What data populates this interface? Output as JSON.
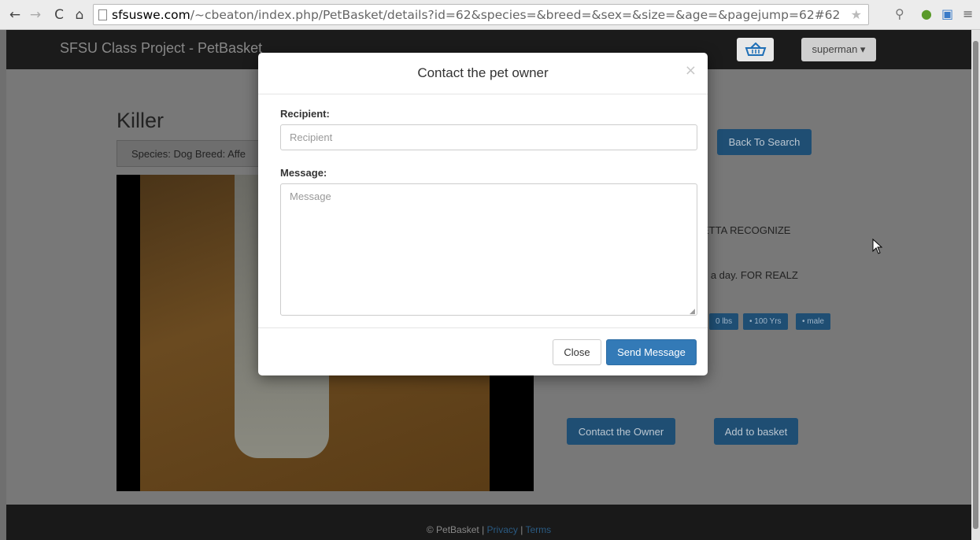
{
  "browser": {
    "url_host": "sfsuswe.com",
    "url_path": "/~cbeaton/index.php/PetBasket/details?id=62&species=&breed=&sex=&size=&age=&pagejump=62#62"
  },
  "navbar": {
    "brand": "SFSU Class Project - PetBasket",
    "user_menu": "superman ▾"
  },
  "pet": {
    "name": "Killer",
    "meta": "Species: Dog   Breed: Affe",
    "desc_line1": "ETTA RECOGNIZE",
    "desc_line2": "e a day. FOR REALZ",
    "tags": [
      "0 lbs",
      "• 100 Yrs",
      "• male"
    ]
  },
  "actions": {
    "back_to_search": "Back To Search",
    "contact_owner": "Contact the Owner",
    "add_to_basket": "Add to basket"
  },
  "footer": {
    "copyright": "© PetBasket | ",
    "privacy": "Privacy",
    "sep": " | ",
    "terms": "Terms"
  },
  "modal": {
    "title": "Contact the pet owner",
    "close_x": "×",
    "recipient_label": "Recipient:",
    "recipient_placeholder": "Recipient",
    "message_label": "Message:",
    "message_placeholder": "Message",
    "close_button": "Close",
    "send_button": "Send Message"
  },
  "colors": {
    "primary": "#337ab7",
    "navbar": "#1b1b1b",
    "backdrop": "#787878"
  },
  "icons": [
    "back-arrow-icon",
    "forward-arrow-icon",
    "reload-icon",
    "home-icon",
    "page-icon",
    "star-icon",
    "basket-icon",
    "close-icon",
    "mouse-cursor-icon"
  ]
}
